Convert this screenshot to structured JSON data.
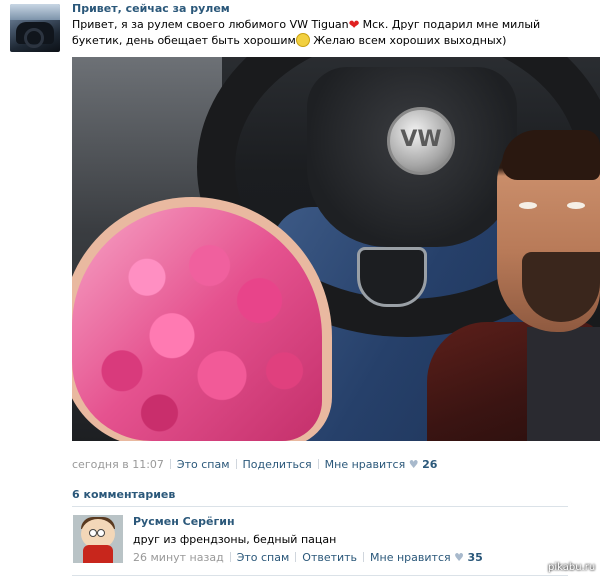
{
  "post": {
    "title": "Привет, сейчас за рулем",
    "text_part1": "Привет, я за рулем своего любимого VW Tiguan",
    "text_part2": "Мск. Друг подарил мне милый букетик, день обещает быть хорошим",
    "text_part3": " Желаю всем хороших выходных)",
    "heart_emoji": "❤",
    "meta": {
      "time": "сегодня в 11:07",
      "spam": "Это спам",
      "share": "Поделиться",
      "like": "Мне нравится",
      "heart": "♥",
      "likes_count": "26"
    }
  },
  "comments": {
    "header": "6 комментариев",
    "items": [
      {
        "author": "Русмен Серёгин",
        "text": "друг из френдзоны, бедный пацан",
        "time": "26 минут назад",
        "spam": "Это спам",
        "reply": "Ответить",
        "like": "Мне нравится",
        "heart": "♥",
        "likes_count": "35"
      }
    ]
  },
  "watermark": "pikabu.ru"
}
